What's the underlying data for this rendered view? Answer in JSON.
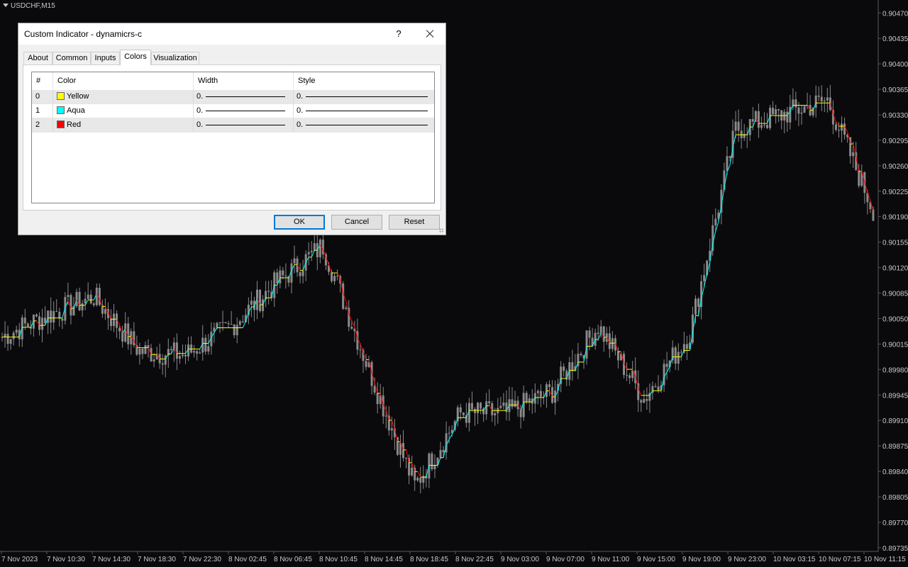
{
  "chart": {
    "symbol": "USDCHF,M15",
    "background": "#0a0a0d",
    "candle_color": "#8a8a8a",
    "price_axis": [
      "0.90470",
      "0.90435",
      "0.90400",
      "0.90365",
      "0.90330",
      "0.90295",
      "0.90260",
      "0.90225",
      "0.90190",
      "0.90155",
      "0.90120",
      "0.90085",
      "0.90050",
      "0.90015",
      "0.89980",
      "0.89945",
      "0.89910",
      "0.89875",
      "0.89840",
      "0.89805",
      "0.89770",
      "0.89735"
    ],
    "time_axis": [
      "7 Nov 2023",
      "7 Nov 10:30",
      "7 Nov 14:30",
      "7 Nov 18:30",
      "7 Nov 22:30",
      "8 Nov 02:45",
      "8 Nov 06:45",
      "8 Nov 10:45",
      "8 Nov 14:45",
      "8 Nov 18:45",
      "8 Nov 22:45",
      "9 Nov 03:00",
      "9 Nov 07:00",
      "9 Nov 11:00",
      "9 Nov 15:00",
      "9 Nov 19:00",
      "9 Nov 23:00",
      "10 Nov 03:15",
      "10 Nov 07:15",
      "10 Nov 11:15"
    ]
  },
  "chart_data": {
    "type": "line",
    "title": "USDCHF,M15",
    "ylim": [
      0.8973,
      0.9048
    ],
    "x": [
      "7 Nov 2023",
      "7 Nov 10:30",
      "7 Nov 14:30",
      "7 Nov 18:30",
      "7 Nov 22:30",
      "8 Nov 02:45",
      "8 Nov 06:45",
      "8 Nov 10:45",
      "8 Nov 14:45",
      "8 Nov 18:45",
      "8 Nov 22:45",
      "9 Nov 03:00",
      "9 Nov 07:00",
      "9 Nov 11:00",
      "9 Nov 15:00",
      "9 Nov 19:00",
      "9 Nov 23:00",
      "10 Nov 03:15",
      "10 Nov 07:15",
      "10 Nov 11:15"
    ],
    "series": [
      {
        "values": [
          0.90025,
          0.90055,
          0.9008,
          0.90005,
          0.9,
          0.9004,
          0.901,
          0.9015,
          0.8998,
          0.8982,
          0.8992,
          0.8992,
          0.8995,
          0.9004,
          0.8994,
          0.9003,
          0.9031,
          0.9033,
          0.9035,
          0.902
        ]
      }
    ]
  },
  "dialog": {
    "title": "Custom Indicator - dynamicrs-c",
    "help": "?",
    "tabs": [
      "About",
      "Common",
      "Inputs",
      "Colors",
      "Visualization"
    ],
    "active_tab": "Colors",
    "columns": [
      "#",
      "Color",
      "Width",
      "Style"
    ],
    "rows": [
      {
        "index": "0",
        "color_name": "Yellow",
        "color": "#ffff00",
        "width": "0.",
        "style": "0."
      },
      {
        "index": "1",
        "color_name": "Aqua",
        "color": "#00ffff",
        "width": "0.",
        "style": "0."
      },
      {
        "index": "2",
        "color_name": "Red",
        "color": "#ff0000",
        "width": "0.",
        "style": "0."
      }
    ],
    "buttons": {
      "ok": "OK",
      "cancel": "Cancel",
      "reset": "Reset"
    }
  }
}
